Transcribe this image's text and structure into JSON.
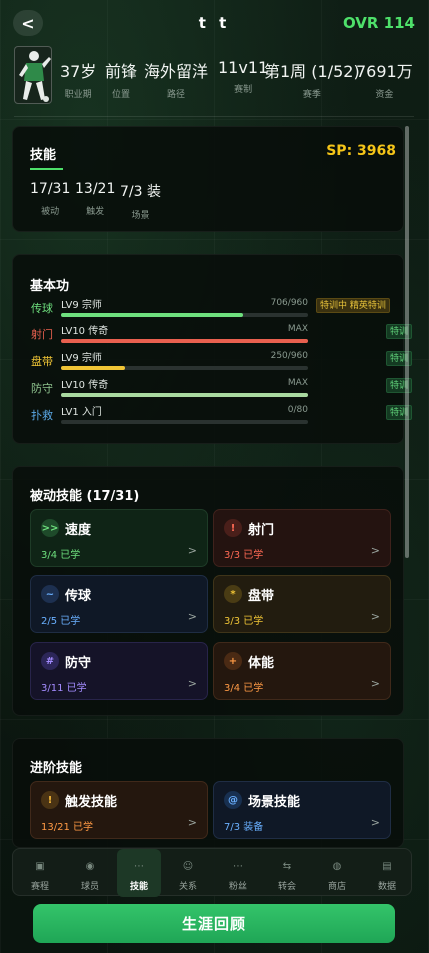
{
  "header": {
    "back_glyph": "<",
    "player_name": "t t",
    "ovr": "OVR 114"
  },
  "info": [
    {
      "value": "37岁",
      "label": "职业期"
    },
    {
      "value": "前锋",
      "label": "位置"
    },
    {
      "value": "海外留洋",
      "label": "路径"
    },
    {
      "value": "11v11",
      "label": "赛制"
    },
    {
      "value": "第1周 (1/52)",
      "label": "赛季"
    },
    {
      "value": "7691万",
      "label": "资金"
    }
  ],
  "skills": {
    "title": "技能",
    "sp": "SP: 3968",
    "summary": [
      {
        "value": "17/31",
        "label": "被动"
      },
      {
        "value": "13/21",
        "label": "触发"
      },
      {
        "value": "7/3 装",
        "label": "场景"
      }
    ]
  },
  "basic": {
    "title": "基本功",
    "rows": [
      {
        "name": "传球",
        "name_color": "#6ee07e",
        "level": "LV9 宗师",
        "xp": "706/960",
        "progress": 0.735,
        "bar_color": "#6ee07e",
        "tag": "特训中 精英特训",
        "tag_style": "gold"
      },
      {
        "name": "射门",
        "name_color": "#e8604f",
        "level": "LV10 传奇",
        "xp": "MAX",
        "progress": 1.0,
        "bar_color": "#e8604f",
        "tag": "特训",
        "tag_style": "green"
      },
      {
        "name": "盘带",
        "name_color": "#f0c536",
        "level": "LV9 宗师",
        "xp": "250/960",
        "progress": 0.26,
        "bar_color": "#f0c536",
        "tag": "特训",
        "tag_style": "green"
      },
      {
        "name": "防守",
        "name_color": "#8fc48f",
        "level": "LV10 传奇",
        "xp": "MAX",
        "progress": 1.0,
        "bar_color": "#a9d9a0",
        "tag": "特训",
        "tag_style": "green"
      },
      {
        "name": "扑救",
        "name_color": "#5aa8e6",
        "level": "LV1 入门",
        "xp": "0/80",
        "progress": 0.0,
        "bar_color": "#5aa8e6",
        "tag": "特训",
        "tag_style": "green"
      }
    ]
  },
  "passive": {
    "title": "被动技能 (17/31)",
    "tiles": [
      {
        "icon": "speed-icon",
        "glyph": ">>",
        "name": "速度",
        "stat": "3/4 已学",
        "style": "green",
        "icon_bg": "#1e4a2a",
        "icon_color": "#6ee07e",
        "stat_color": "#6ee07e"
      },
      {
        "icon": "shoot-icon",
        "glyph": "!",
        "name": "射门",
        "stat": "3/3 已学",
        "style": "red",
        "icon_bg": "#4a1f1a",
        "icon_color": "#ff6a55",
        "stat_color": "#ff6a55"
      },
      {
        "icon": "pass-icon",
        "glyph": "~",
        "name": "传球",
        "stat": "2/5 已学",
        "style": "blue",
        "icon_bg": "#1d3050",
        "icon_color": "#6ab0ff",
        "stat_color": "#6ab0ff"
      },
      {
        "icon": "dribble-icon",
        "glyph": "*",
        "name": "盘带",
        "stat": "3/3 已学",
        "style": "gold",
        "icon_bg": "#4a3c14",
        "icon_color": "#f0c536",
        "stat_color": "#f0c536"
      },
      {
        "icon": "defense-icon",
        "glyph": "#",
        "name": "防守",
        "stat": "3/11 已学",
        "style": "purple",
        "icon_bg": "#2c2658",
        "icon_color": "#a48cff",
        "stat_color": "#a48cff"
      },
      {
        "icon": "stamina-icon",
        "glyph": "+",
        "name": "体能",
        "stat": "3/4 已学",
        "style": "orange",
        "icon_bg": "#4a2a14",
        "icon_color": "#ff9a45",
        "stat_color": "#ff9a45"
      }
    ],
    "chevron": ">"
  },
  "advanced": {
    "title": "进阶技能",
    "tiles": [
      {
        "icon": "trigger-icon",
        "glyph": "!",
        "name": "触发技能",
        "stat": "13/21 已学",
        "style": "orange",
        "icon_bg": "#4a3314",
        "icon_color": "#f2b63a",
        "stat_color": "#ff9a45"
      },
      {
        "icon": "scene-icon",
        "glyph": "@",
        "name": "场景技能",
        "stat": "7/3 装备",
        "style": "blue",
        "icon_bg": "#183050",
        "icon_color": "#6ab0ff",
        "stat_color": "#6ab0ff"
      }
    ]
  },
  "nav": [
    {
      "label": "赛程",
      "icon": "schedule-icon",
      "glyph": "▣",
      "active": false
    },
    {
      "label": "球员",
      "icon": "player-icon",
      "glyph": "◉",
      "active": false
    },
    {
      "label": "技能",
      "icon": "skills-icon",
      "glyph": "⋯",
      "active": true
    },
    {
      "label": "关系",
      "icon": "relations-icon",
      "glyph": "☺",
      "active": false
    },
    {
      "label": "粉丝",
      "icon": "fans-icon",
      "glyph": "⋯",
      "active": false
    },
    {
      "label": "转会",
      "icon": "transfer-icon",
      "glyph": "⇆",
      "active": false
    },
    {
      "label": "商店",
      "icon": "shop-icon",
      "glyph": "◍",
      "active": false
    },
    {
      "label": "数据",
      "icon": "stats-icon",
      "glyph": "▤",
      "active": false
    }
  ],
  "career_button": "生涯回顾"
}
